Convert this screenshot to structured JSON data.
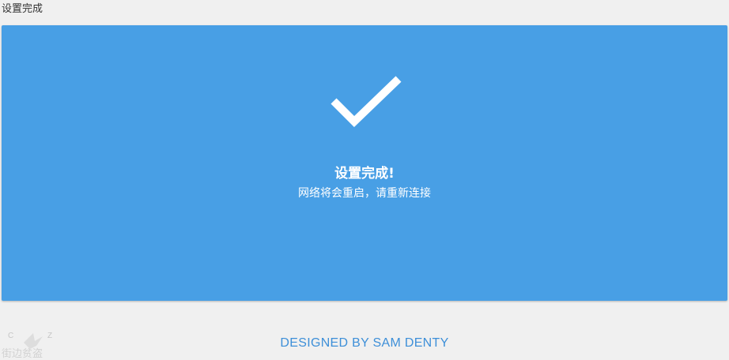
{
  "page": {
    "title": "设置完成"
  },
  "status_panel": {
    "icon": "checkmark-icon",
    "background_color": "#489fe5",
    "title": "设置完成!",
    "message": "网络将会重启，请重新连接"
  },
  "footer": {
    "credit": "DESIGNED BY SAM DENTY"
  },
  "watermark": {
    "text": "C Z 街边贫盗"
  }
}
